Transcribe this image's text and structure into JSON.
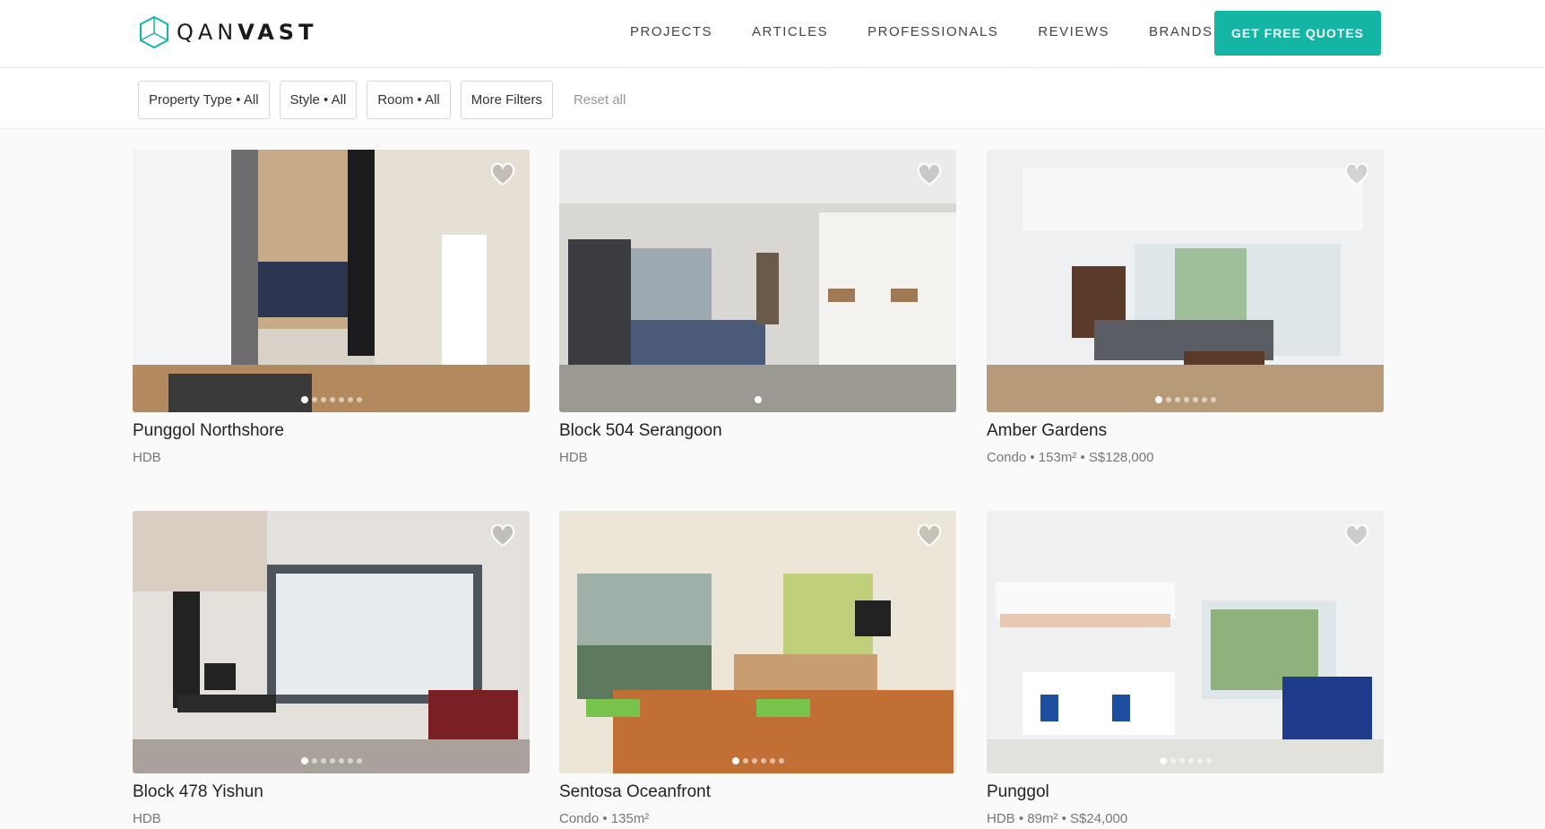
{
  "brand": {
    "name_light": "QAN",
    "name_bold": "VAST",
    "logo_icon": "house-outline-icon",
    "accent": "#15b5a6"
  },
  "nav": {
    "items": [
      "PROJECTS",
      "ARTICLES",
      "PROFESSIONALS",
      "REVIEWS",
      "BRANDS"
    ],
    "cta": "GET FREE QUOTES"
  },
  "filters": {
    "property_type": "Property Type • All",
    "style": "Style • All",
    "room": "Room • All",
    "more": "More Filters",
    "reset": "Reset all"
  },
  "projects": [
    {
      "title": "Punggol Northshore",
      "meta": "HDB",
      "photos": 7,
      "active_photo": 1
    },
    {
      "title": "Block 504 Serangoon",
      "meta": "HDB",
      "photos": 1,
      "active_photo": 1
    },
    {
      "title": "Amber Gardens",
      "meta": "Condo • 153m² • S$128,000",
      "photos": 7,
      "active_photo": 1
    },
    {
      "title": "Block 478 Yishun",
      "meta": "HDB",
      "photos": 7,
      "active_photo": 1
    },
    {
      "title": "Sentosa Oceanfront",
      "meta": "Condo • 135m²",
      "photos": 6,
      "active_photo": 1
    },
    {
      "title": "Punggol",
      "meta": "HDB • 89m² • S$24,000",
      "photos": 6,
      "active_photo": 1
    }
  ]
}
